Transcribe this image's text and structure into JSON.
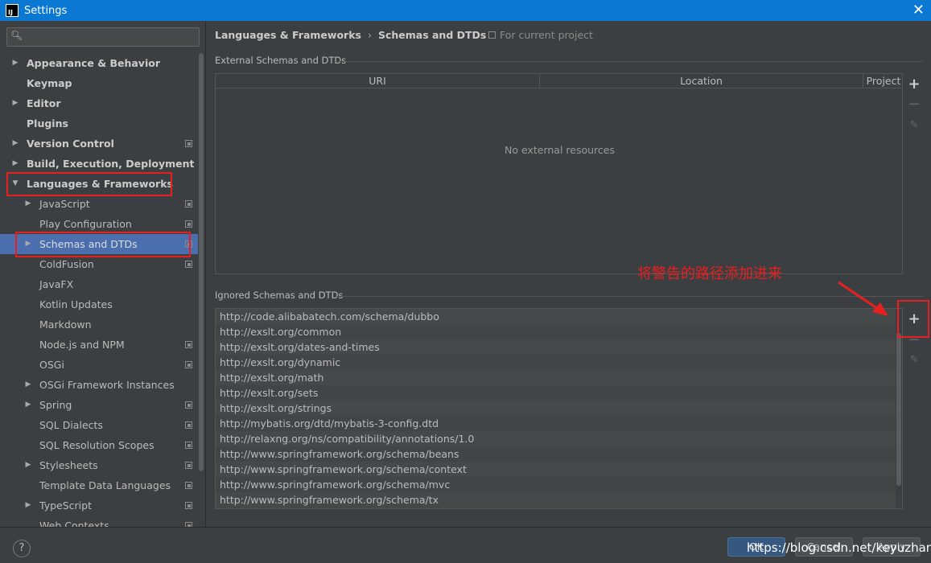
{
  "window": {
    "title": "Settings",
    "app_icon_text": "IJ"
  },
  "search": {
    "placeholder": "",
    "value": ""
  },
  "sidebar": {
    "items": [
      {
        "label": "Appearance & Behavior",
        "level": 0,
        "arrow": "right",
        "project": false
      },
      {
        "label": "Keymap",
        "level": 0,
        "arrow": "none",
        "project": false
      },
      {
        "label": "Editor",
        "level": 0,
        "arrow": "right",
        "project": false
      },
      {
        "label": "Plugins",
        "level": 0,
        "arrow": "none",
        "project": false
      },
      {
        "label": "Version Control",
        "level": 0,
        "arrow": "right",
        "project": true
      },
      {
        "label": "Build, Execution, Deployment",
        "level": 0,
        "arrow": "right",
        "project": false
      },
      {
        "label": "Languages & Frameworks",
        "level": 0,
        "arrow": "down",
        "project": false
      },
      {
        "label": "JavaScript",
        "level": 1,
        "arrow": "right",
        "project": true
      },
      {
        "label": "Play Configuration",
        "level": 1,
        "arrow": "none",
        "project": true
      },
      {
        "label": "Schemas and DTDs",
        "level": 1,
        "arrow": "right",
        "project": true,
        "selected": true
      },
      {
        "label": "ColdFusion",
        "level": 1,
        "arrow": "none",
        "project": true
      },
      {
        "label": "JavaFX",
        "level": 1,
        "arrow": "none",
        "project": false
      },
      {
        "label": "Kotlin Updates",
        "level": 1,
        "arrow": "none",
        "project": false
      },
      {
        "label": "Markdown",
        "level": 1,
        "arrow": "none",
        "project": false
      },
      {
        "label": "Node.js and NPM",
        "level": 1,
        "arrow": "none",
        "project": true
      },
      {
        "label": "OSGi",
        "level": 1,
        "arrow": "none",
        "project": true
      },
      {
        "label": "OSGi Framework Instances",
        "level": 1,
        "arrow": "right",
        "project": false
      },
      {
        "label": "Spring",
        "level": 1,
        "arrow": "right",
        "project": true
      },
      {
        "label": "SQL Dialects",
        "level": 1,
        "arrow": "none",
        "project": true
      },
      {
        "label": "SQL Resolution Scopes",
        "level": 1,
        "arrow": "none",
        "project": true
      },
      {
        "label": "Stylesheets",
        "level": 1,
        "arrow": "right",
        "project": true
      },
      {
        "label": "Template Data Languages",
        "level": 1,
        "arrow": "none",
        "project": true
      },
      {
        "label": "TypeScript",
        "level": 1,
        "arrow": "right",
        "project": true
      },
      {
        "label": "Web Contexts",
        "level": 1,
        "arrow": "none",
        "project": true
      }
    ]
  },
  "breadcrumb": {
    "parent": "Languages & Frameworks",
    "separator": "›",
    "current": "Schemas and DTDs",
    "scope": "For current project"
  },
  "external": {
    "title": "External Schemas and DTDs",
    "columns": [
      "URI",
      "Location",
      "Project"
    ],
    "empty_text": "No external resources"
  },
  "ignored": {
    "title": "Ignored Schemas and DTDs",
    "items": [
      "http://code.alibabatech.com/schema/dubbo",
      "http://exslt.org/common",
      "http://exslt.org/dates-and-times",
      "http://exslt.org/dynamic",
      "http://exslt.org/math",
      "http://exslt.org/sets",
      "http://exslt.org/strings",
      "http://mybatis.org/dtd/mybatis-3-config.dtd",
      "http://relaxng.org/ns/compatibility/annotations/1.0",
      "http://www.springframework.org/schema/beans",
      "http://www.springframework.org/schema/context",
      "http://www.springframework.org/schema/mvc",
      "http://www.springframework.org/schema/tx"
    ]
  },
  "toolbar": {
    "add": "+",
    "remove": "−",
    "edit": "✎"
  },
  "annotation": {
    "text": "将警告的路径添加进来",
    "color": "#e81f1f"
  },
  "footer": {
    "help": "?",
    "ok": "OK",
    "cancel": "Cancel",
    "apply": "Apply",
    "watermark": "https://blog.csdn.net/keyuzhang"
  },
  "colors": {
    "titlebar": "#0b78d4",
    "background": "#3c3f41",
    "selection": "#4b6eaf",
    "highlight_box": "#e81f1f"
  }
}
